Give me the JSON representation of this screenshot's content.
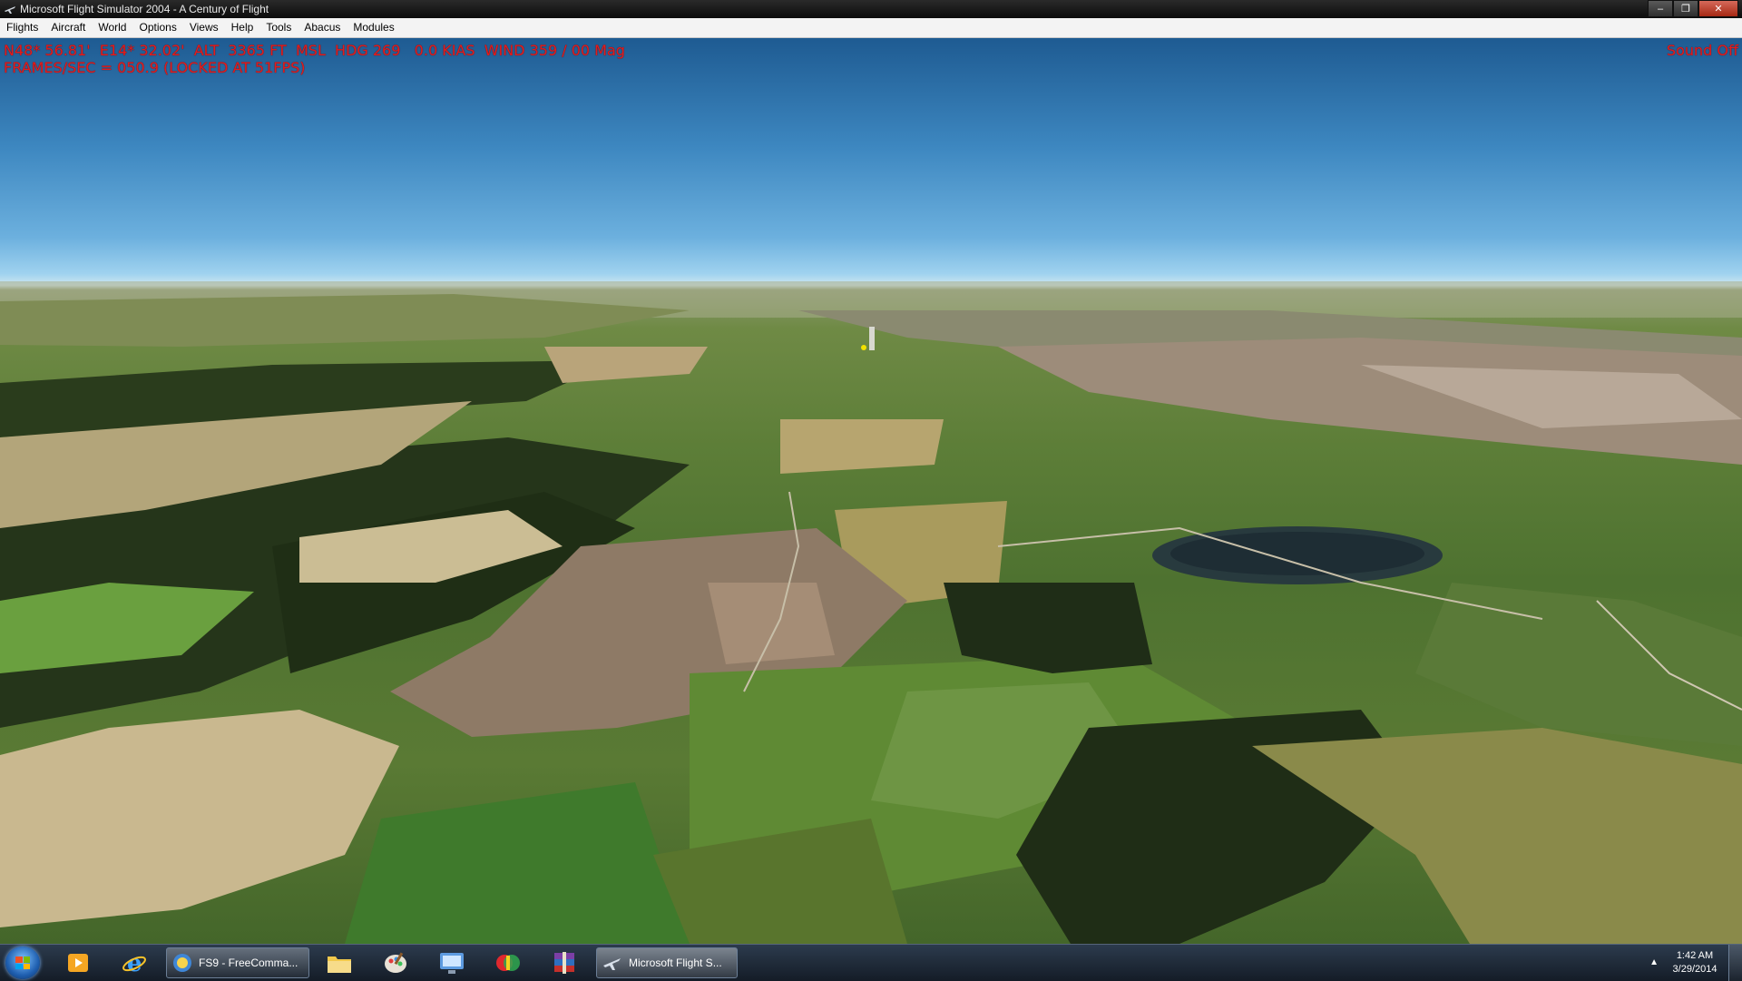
{
  "window": {
    "title": "Microsoft Flight Simulator 2004 - A Century of Flight",
    "controls": [
      "minimize-icon",
      "restore-icon",
      "close-icon"
    ]
  },
  "menubar": {
    "items": [
      "Flights",
      "Aircraft",
      "World",
      "Options",
      "Views",
      "Help",
      "Tools",
      "Abacus",
      "Modules"
    ]
  },
  "hud": {
    "line1": "N48* 56.81'  E14* 32.02'  ALT  3365 FT  MSL  HDG 269   0.0 KIAS  WIND 359 / 00 Mag",
    "line2": "FRAMES/SEC = 050.9 (LOCKED AT 51FPS)",
    "sound": "Sound Off",
    "color": "#e51b1b"
  },
  "taskbar": {
    "pinned": [
      "start-orb-icon",
      "media-player-icon",
      "internet-explorer-icon"
    ],
    "tasks": [
      {
        "label": "FS9 - FreeComma...",
        "icon": "fs9-globe-icon"
      },
      {
        "label": "Microsoft Flight S...",
        "icon": "airplane-icon"
      }
    ],
    "pinned_after": [
      "folder-icon",
      "paint-icon",
      "control-panel-icon",
      "colorful-app-icon",
      "winrar-icon"
    ],
    "clock": {
      "time": "1:42 AM",
      "date": "3/29/2014"
    }
  }
}
